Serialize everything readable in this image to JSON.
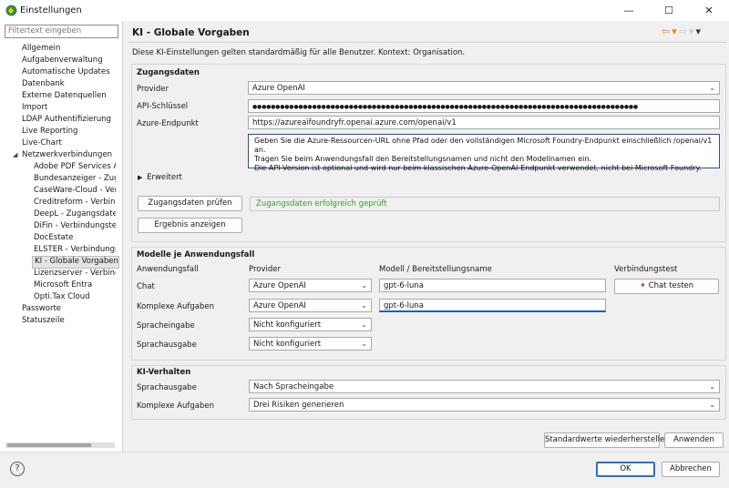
{
  "window": {
    "title": "Einstellungen",
    "minimize": "—",
    "maximize": "☐",
    "close": "✕"
  },
  "sidebar": {
    "filter_placeholder": "Filtertext eingeben",
    "items": [
      {
        "label": "Allgemein"
      },
      {
        "label": "Aufgabenverwaltung"
      },
      {
        "label": "Automatische Updates"
      },
      {
        "label": "Datenbank"
      },
      {
        "label": "Externe Datenquellen"
      },
      {
        "label": "Import"
      },
      {
        "label": "LDAP Authentifizierung"
      },
      {
        "label": "Live Reporting"
      },
      {
        "label": "Live-Chart"
      },
      {
        "label": "Netzwerkverbindungen"
      },
      {
        "label": "Adobe PDF Services AP"
      },
      {
        "label": "Bundesanzeiger - Zugar"
      },
      {
        "label": "CaseWare-Cloud - Verb"
      },
      {
        "label": "Creditreform - Verbindu"
      },
      {
        "label": "DeepL - Zugangsdaten"
      },
      {
        "label": "DiFin - Verbindungstest"
      },
      {
        "label": "DocEstate"
      },
      {
        "label": "ELSTER - Verbindungste"
      },
      {
        "label": "KI - Globale Vorgaben"
      },
      {
        "label": "Lizenzserver - Verbindu"
      },
      {
        "label": "Microsoft Entra"
      },
      {
        "label": "Opti.Tax Cloud"
      },
      {
        "label": "Passworte"
      },
      {
        "label": "Statuszeile"
      }
    ]
  },
  "page": {
    "title": "KI - Globale Vorgaben",
    "description": "Diese KI-Einstellungen gelten standardmäßig für alle Benutzer. Kontext: Organisation."
  },
  "access": {
    "group_title": "Zugangsdaten",
    "provider_label": "Provider",
    "provider_value": "Azure OpenAI",
    "api_key_label": "API-Schlüssel",
    "api_key_value": "●●●●●●●●●●●●●●●●●●●●●●●●●●●●●●●●●●●●●●●●●●●●●●●●●●●●●●●●●●●●●●●●●●●●●●●●●●●●●●●●●●●●",
    "endpoint_label": "Azure-Endpunkt",
    "endpoint_value": "https://azureaifoundryfr.openai.azure.com/openai/v1",
    "info_line1": "Geben Sie die Azure-Ressourcen-URL ohne Pfad oder den vollständigen Microsoft Foundry-Endpunkt einschließlich /openai/v1 an.",
    "info_line2": "Tragen Sie beim Anwendungsfall den Bereitstellungsnamen und nicht den Modellnamen ein.",
    "info_line3": "Die API-Version ist optional und wird nur beim klassischen Azure-OpenAI-Endpunkt verwendet, nicht bei Microsoft Foundry.",
    "advanced_label": "Erweitert",
    "check_button": "Zugangsdaten prüfen",
    "status_text": "Zugangsdaten erfolgreich geprüft",
    "result_button": "Ergebnis anzeigen"
  },
  "models": {
    "group_title": "Modelle je Anwendungsfall",
    "col_usecase": "Anwendungsfall",
    "col_provider": "Provider",
    "col_model": "Modell / Bereitstellungsname",
    "col_test": "Verbindungstest",
    "rows": [
      {
        "usecase": "Chat",
        "provider": "Azure OpenAI",
        "model": "gpt-6-luna"
      },
      {
        "usecase": "Komplexe Aufgaben",
        "provider": "Azure OpenAI",
        "model": "gpt-6-luna"
      },
      {
        "usecase": "Spracheingabe",
        "provider": "Nicht konfiguriert",
        "model": ""
      },
      {
        "usecase": "Sprachausgabe",
        "provider": "Nicht konfiguriert",
        "model": ""
      }
    ],
    "chat_test_button": "Chat testen"
  },
  "behavior": {
    "group_title": "KI-Verhalten",
    "speech_label": "Sprachausgabe",
    "speech_value": "Nach Spracheingabe",
    "complex_label": "Komplexe Aufgaben",
    "complex_value": "Drei Risiken generieren"
  },
  "footer": {
    "restore_button": "Standardwerte wiederherstellen",
    "apply_button": "Anwenden",
    "ok_button": "OK",
    "cancel_button": "Abbrechen",
    "help": "?"
  },
  "colors": {
    "success": "#3a9a2e",
    "accent": "#1f5fa8"
  }
}
